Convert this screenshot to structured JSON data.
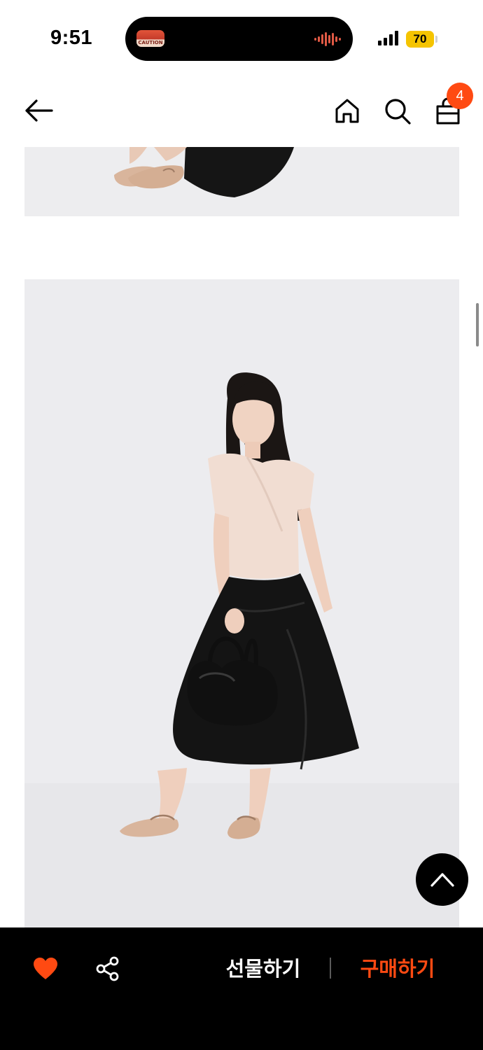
{
  "status_bar": {
    "time": "9:51",
    "island_thumbnail_text": "CAUTION",
    "battery": "70",
    "battery_color": "#f5c400"
  },
  "header": {
    "back_icon": "arrow-left-icon",
    "home_icon": "home-icon",
    "search_icon": "search-icon",
    "cart_icon": "shopping-bag-icon",
    "cart_count": "4",
    "badge_color": "#ff4a12"
  },
  "content": {
    "images": [
      "product-photo-partial",
      "product-photo-model"
    ]
  },
  "floating": {
    "scroll_top_icon": "chevron-up-icon"
  },
  "bottom_bar": {
    "like_icon": "heart-icon",
    "share_icon": "share-icon",
    "gift_label": "선물하기",
    "buy_label": "구매하기",
    "accent_color": "#ff4a12"
  }
}
